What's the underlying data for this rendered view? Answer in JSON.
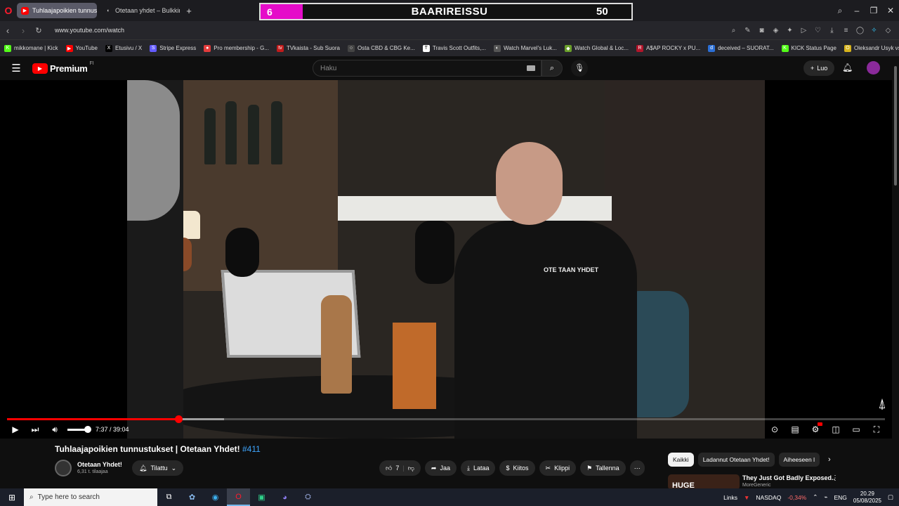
{
  "browser": {
    "tabs": [
      {
        "label": "Tuhlaajapoikien tunnustu",
        "active": true,
        "icon": "youtube-icon"
      },
      {
        "label": "Otetaan yhdet – Bulkkinen",
        "active": false,
        "icon": "audio-icon"
      }
    ],
    "overlay": {
      "left_number": "6",
      "title": "BAARIREISSU",
      "right_number": "50",
      "accent_color": "#e50cc9"
    },
    "url": "www.youtube.com/watch",
    "bookmarks": [
      {
        "label": "mikkomane | Kick",
        "icon_color": "#53fc18",
        "glyph": "K"
      },
      {
        "label": "YouTube",
        "icon_color": "#ff0000",
        "glyph": "▶"
      },
      {
        "label": "Etusivu / X",
        "icon_color": "#000000",
        "glyph": "X"
      },
      {
        "label": "Stripe Express",
        "icon_color": "#635bff",
        "glyph": "S"
      },
      {
        "label": "Pro membership - G...",
        "icon_color": "#e23c3c",
        "glyph": "●"
      },
      {
        "label": "TVkaista - Sub Suora",
        "icon_color": "#c21b1b",
        "glyph": "tv"
      },
      {
        "label": "Osta CBD & CBG Ke...",
        "icon_color": "#444444",
        "glyph": "○"
      },
      {
        "label": "Travis Scott Outfits,...",
        "icon_color": "#ffffff",
        "glyph": "T"
      },
      {
        "label": "Watch Marvel's Luk...",
        "icon_color": "#555555",
        "glyph": "◐"
      },
      {
        "label": "Watch Global & Loc...",
        "icon_color": "#6a9f2a",
        "glyph": "◆"
      },
      {
        "label": "A$AP ROCKY x PU...",
        "icon_color": "#b2152a",
        "glyph": "R"
      },
      {
        "label": "deceived – SUORAT...",
        "icon_color": "#2b6fd6",
        "glyph": "d"
      },
      {
        "label": "KICK Status Page",
        "icon_color": "#53fc18",
        "glyph": "K"
      },
      {
        "label": "Oleksandr Usyk vs D...",
        "icon_color": "#d6b31c",
        "glyph": "O"
      }
    ]
  },
  "youtube": {
    "brand": "Premium",
    "region": "FI",
    "search_placeholder": "Haku",
    "create_label": "Luo",
    "player": {
      "current_time": "7:37",
      "duration": "39:04",
      "time_text": "7:37 / 39:04",
      "progress_fraction": 0.195,
      "buffered_fraction": 0.247,
      "volume_fraction": 1.0,
      "shirt_text": "OTE TAAN YHDET"
    },
    "video": {
      "title": "Tuhlaajapoikien tunnustukset | Otetaan Yhdet!",
      "hashtag": "#411",
      "channel_name": "Otetaan Yhdet!",
      "subscribers": "6,31 t. tilaajaa",
      "subscribe_label": "Tilattu",
      "likes": "7",
      "share_label": "Jaa",
      "download_label": "Lataa",
      "thanks_label": "Kiitos",
      "clip_label": "Klippi",
      "save_label": "Tallenna"
    },
    "chips": [
      "Kaikki",
      "Ladannut Otetaan Yhdet!",
      "Aiheeseen l"
    ],
    "recommendation": {
      "thumb_text": "HUGE",
      "title": "They Just Got Badly Exposed..",
      "channel": "MoreGeneric"
    }
  },
  "taskbar": {
    "search_placeholder": "Type here to search",
    "links_label": "Links",
    "ticker": "NASDAQ",
    "ticker_change": "-0,34%",
    "language": "ENG",
    "time": "20.29",
    "date": "05/08/2025"
  }
}
